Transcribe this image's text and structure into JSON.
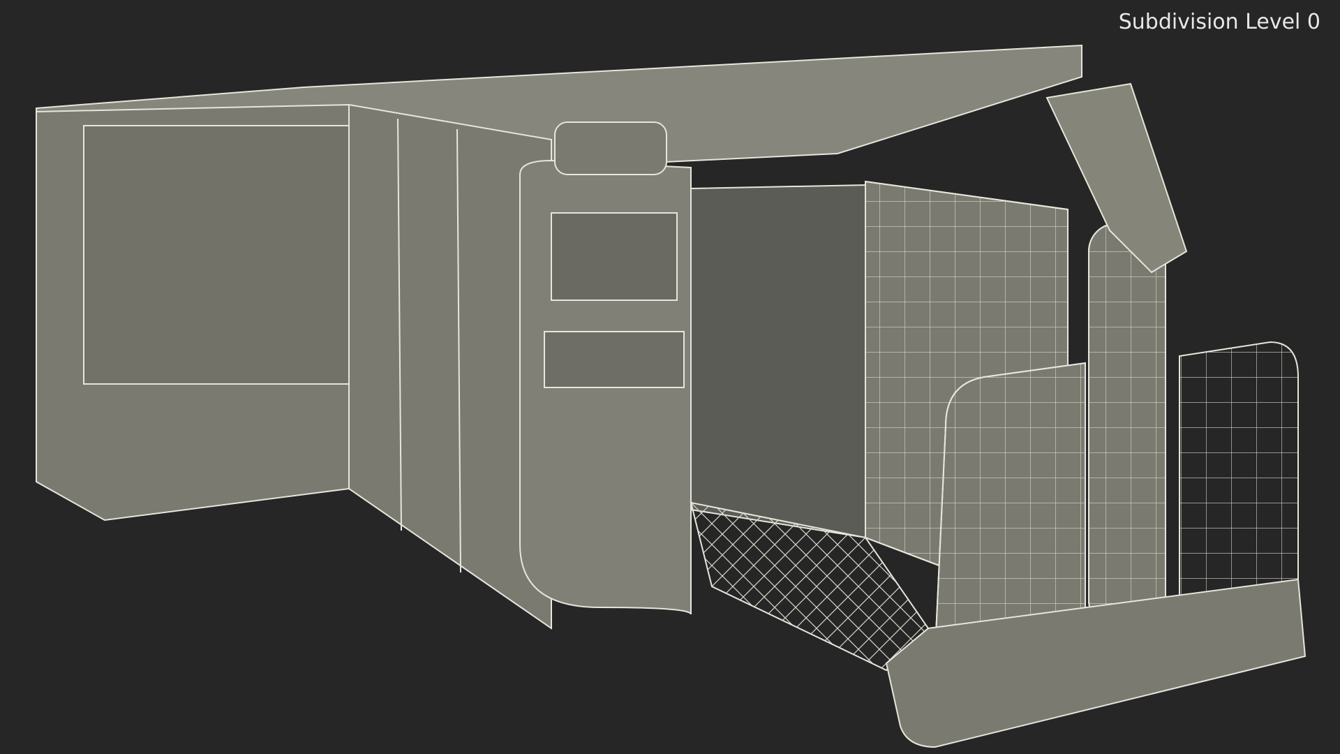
{
  "overlay": {
    "label": "Subdivision Level 0"
  },
  "colors": {
    "background": "#262626",
    "surface": "#7a7a70",
    "wire": "#e6e6dc"
  }
}
